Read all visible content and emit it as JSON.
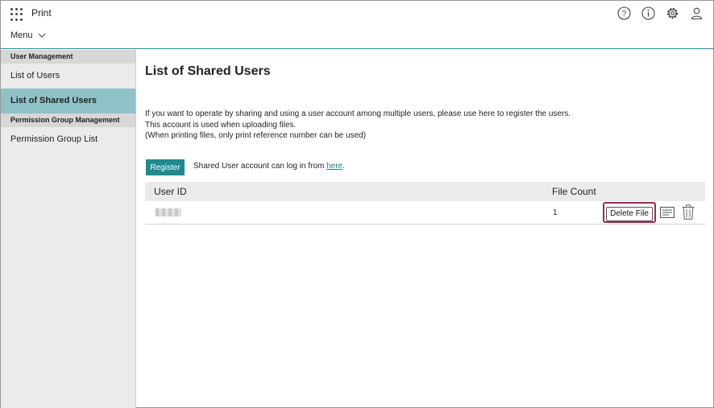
{
  "header": {
    "app_title": "Print",
    "menu_label": "Menu",
    "icons": [
      "apps-icon",
      "help-icon",
      "info-icon",
      "settings-icon",
      "user-icon"
    ]
  },
  "sidebar": {
    "sections": [
      {
        "title": "User Management",
        "items": [
          {
            "label": "List of Users",
            "active": false
          },
          {
            "label": "List of Shared Users",
            "active": true
          }
        ]
      },
      {
        "title": "Permission Group Management",
        "items": [
          {
            "label": "Permission Group List",
            "active": false
          }
        ]
      }
    ]
  },
  "main": {
    "title": "List of Shared Users",
    "description": [
      "If you want to operate by sharing and using a user account among multiple users, please use here to register the users.",
      "This account is used when uploading files.",
      "(When printing files, only print reference number can be used)"
    ],
    "register_label": "Register",
    "login_note_prefix": "Shared User account can log in from ",
    "login_note_link": "here",
    "login_note_suffix": ".",
    "table": {
      "columns": [
        "User ID",
        "File Count"
      ],
      "rows": [
        {
          "file_count": "1",
          "delete_label": "Delete File"
        }
      ]
    }
  },
  "colors": {
    "accent": "#1f8a8f",
    "active_item": "#8fc2c7",
    "highlight_border": "#9b2a5b"
  }
}
